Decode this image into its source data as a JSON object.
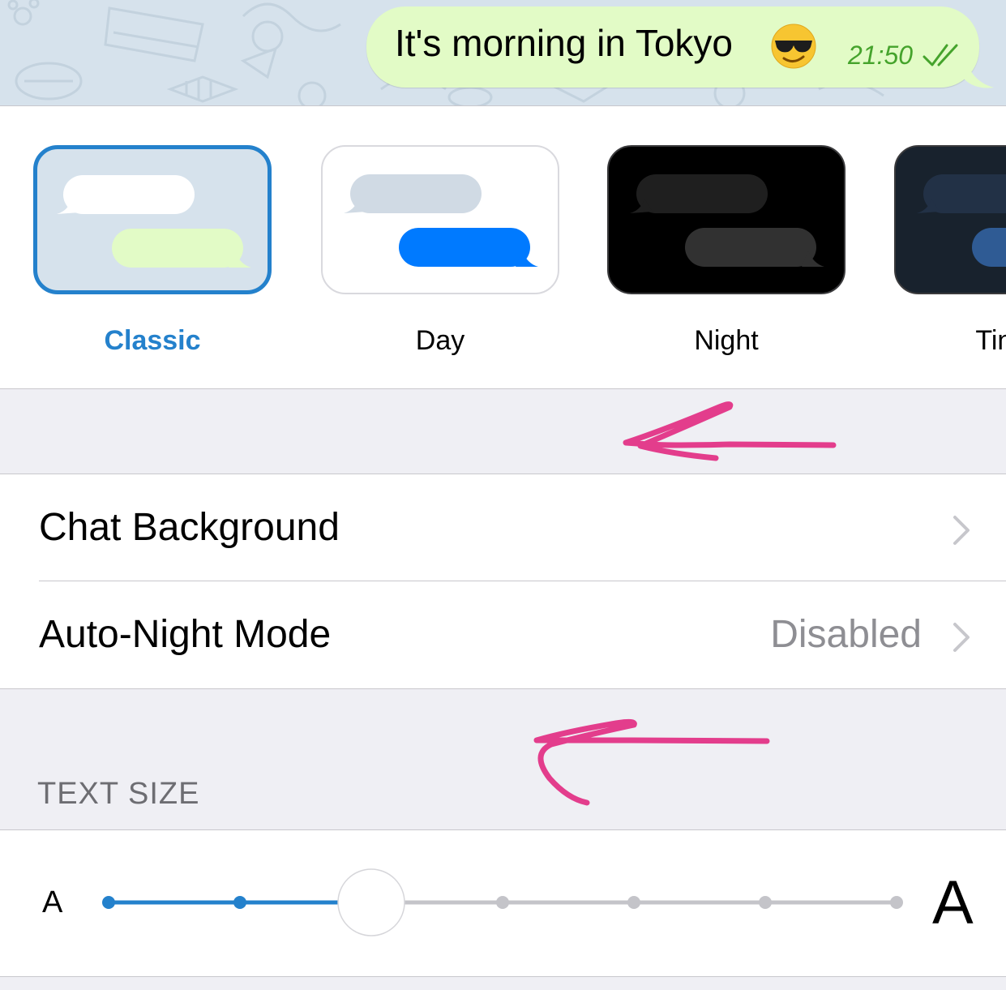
{
  "chat_preview": {
    "message_text": "It's morning in Tokyo",
    "emoji": "smiling-face-with-sunglasses",
    "time": "21:50",
    "status_icon": "double-check-icon",
    "colors": {
      "wallpaper": "#d6e2ec",
      "bubble": "#e2fbc6",
      "time": "#45a32c"
    }
  },
  "themes": {
    "items": [
      {
        "label": "Classic",
        "selected": true
      },
      {
        "label": "Day",
        "selected": false
      },
      {
        "label": "Night",
        "selected": false
      },
      {
        "label": "Tinted",
        "selected": false
      }
    ],
    "accent": "#2481cc"
  },
  "settings": {
    "chat_background": {
      "label": "Chat Background"
    },
    "auto_night_mode": {
      "label": "Auto-Night Mode",
      "value": "Disabled"
    }
  },
  "text_size": {
    "header": "TEXT SIZE",
    "small_label": "A",
    "large_label": "A",
    "steps": 7,
    "selected_step": 3
  }
}
